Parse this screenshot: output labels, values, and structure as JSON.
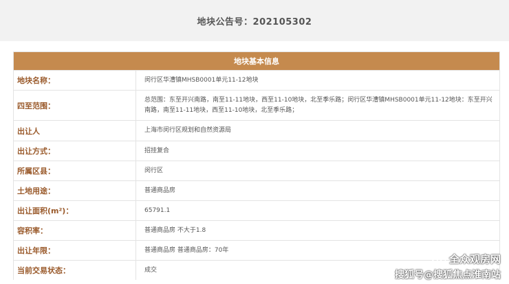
{
  "header": {
    "title": "地块公告号：202105302"
  },
  "table": {
    "caption": "地块基本信息",
    "rows": [
      {
        "label": "地块名称：",
        "value": "闵行区华漕镇MHSB0001单元11-12地块"
      },
      {
        "label": "四至范围：",
        "value": "总范围：东至开兴南路，南至11-11地块，西至11-10地块，北至季乐路；闵行区华漕镇MHSB0001单元11-12地块：东至开兴南路，南至11-11地块，西至11-10地块，北至季乐路；"
      },
      {
        "label": "出让人",
        "value": "上海市闵行区规划和自然资源局"
      },
      {
        "label": "出让方式：",
        "value": "招挂复合"
      },
      {
        "label": "所属区县：",
        "value": "闵行区"
      },
      {
        "label": "土地用途：",
        "value": "普通商品房"
      },
      {
        "label": "出让面积(m²)：",
        "value": "65791.1"
      },
      {
        "label": "容积率：",
        "value": "普通商品房 不大于1.8"
      },
      {
        "label": "出让年限：",
        "value": "普通商品房 普通商品房：70年"
      },
      {
        "label": "当前交易状态：",
        "value": "成交"
      }
    ]
  },
  "watermark": {
    "line1": "全众观房网",
    "line2": "搜狐号@搜狐焦点淮南站",
    "icon": "wechat-icon"
  }
}
